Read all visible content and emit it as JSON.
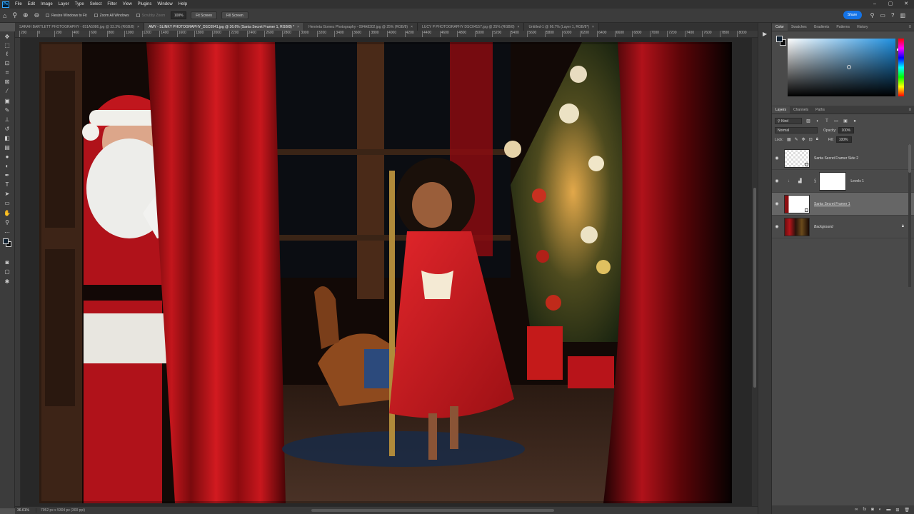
{
  "menubar": {
    "logo": "Ps",
    "items": [
      "File",
      "Edit",
      "Image",
      "Layer",
      "Type",
      "Select",
      "Filter",
      "View",
      "Plugins",
      "Window",
      "Help"
    ],
    "window_controls": [
      "–",
      "▢",
      "✕"
    ]
  },
  "options": {
    "resize_windows": "Resize Windows to Fit",
    "zoom_all": "Zoom All Windows",
    "scrubby_zoom": "Scrubby Zoom",
    "zoom_value": "100%",
    "fit_screen": "Fit Screen",
    "fill_screen": "Fill Screen",
    "share": "Share"
  },
  "tabs": [
    {
      "label": "SARAH BARTLETT PHOTOGRAPHY - 651A5086.jpg @ 33.3% (RGB/8)",
      "active": false
    },
    {
      "label": "AMY - SLINKY PHOTOGRAPHY_DSC0941.jpg @ 36.6% (Santa Secret Framer 1, RGB/8) *",
      "active": true
    },
    {
      "label": "Henrieta Gomez Photography - 094A8302.jpg @ 25% (RGB/8)",
      "active": false
    },
    {
      "label": "LUCY P PHOTOGRAPHY DSC04157.jpg @ 25% (RGB/8)",
      "active": false
    },
    {
      "label": "Untitled-1 @ 66.7% (Layer 1, RGB/8*)",
      "active": false
    }
  ],
  "ruler": {
    "top_ticks": [
      "200",
      "0",
      "200",
      "400",
      "600",
      "800",
      "1000",
      "1200",
      "1400",
      "1600",
      "1800",
      "2000",
      "2200",
      "2400",
      "2600",
      "2800",
      "3000",
      "3200",
      "3400",
      "3600",
      "3800",
      "4000",
      "4200",
      "4400",
      "4600",
      "4800",
      "5000",
      "5200",
      "5400",
      "5600",
      "5800",
      "6000",
      "6200",
      "6400",
      "6600",
      "6800",
      "7000",
      "7200",
      "7400",
      "7600",
      "7800",
      "8000"
    ]
  },
  "status": {
    "zoom": "36.61%",
    "docinfo": "7952 px x 5304 px (300 ppi)"
  },
  "color_panel": {
    "tabs": [
      "Color",
      "Swatches",
      "Gradients",
      "Patterns",
      "History"
    ]
  },
  "layers_panel": {
    "tabs": [
      "Layers",
      "Channels",
      "Paths"
    ],
    "filter_kind": "Kind",
    "blend_mode": "Normal",
    "opacity_label": "Opacity:",
    "opacity_value": "100%",
    "lock_label": "Lock:",
    "fill_label": "Fill:",
    "fill_value": "100%",
    "layers": [
      {
        "name": "Santa Secret Framer Side 2",
        "thumb": "checker",
        "selected": false
      },
      {
        "name": "Levels 1",
        "thumb": "adjustment",
        "selected": false
      },
      {
        "name": "Santa Secret Framer 1",
        "thumb": "framer",
        "selected": true
      },
      {
        "name": "Background",
        "thumb": "photo",
        "selected": false
      }
    ]
  },
  "colors": {
    "accent": "#1473e6",
    "panel_bg": "#4a4a4a",
    "curtain_red": "#b3141a"
  }
}
